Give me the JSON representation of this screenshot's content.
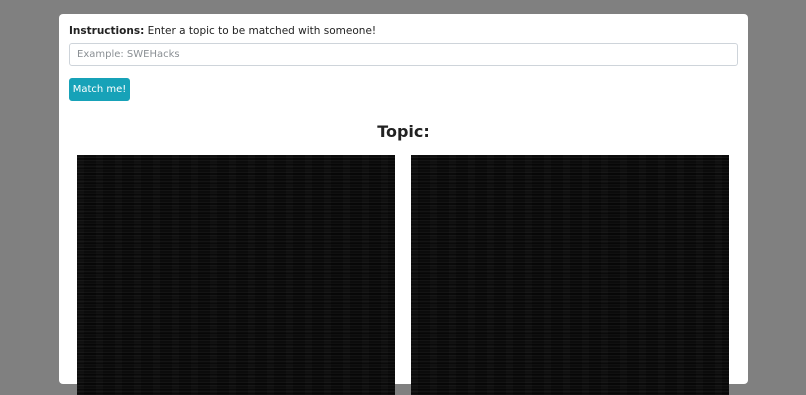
{
  "instructions": {
    "label": "Instructions:",
    "text": "Enter a topic to be matched with someone!"
  },
  "topic_input": {
    "value": "",
    "placeholder": "Example: SWEHacks"
  },
  "match_button": {
    "label": "Match me!"
  },
  "topic": {
    "heading": "Topic:"
  },
  "colors": {
    "page_background": "#808080",
    "card_background": "#ffffff",
    "accent": "#17a2b8",
    "video_background": "#0b0b0b"
  }
}
